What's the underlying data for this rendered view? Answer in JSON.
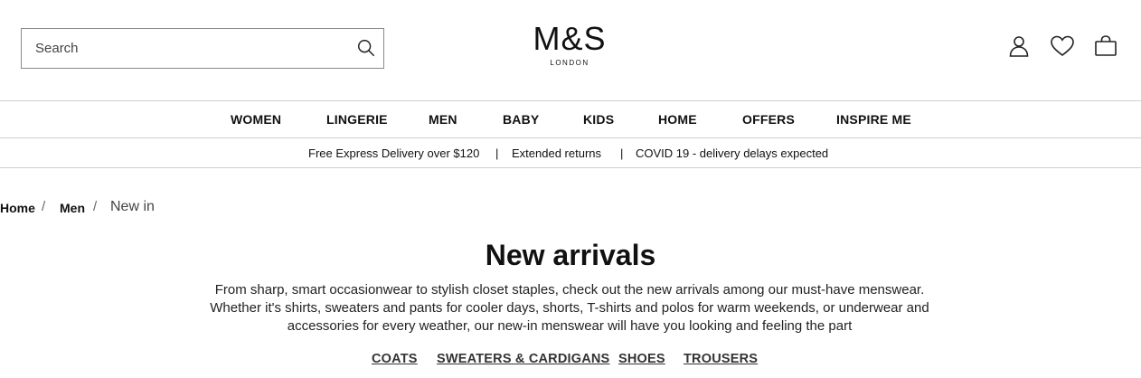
{
  "header": {
    "search": {
      "placeholder": "Search",
      "value": ""
    },
    "logo": {
      "main": "M&S",
      "sub": "LONDON"
    },
    "icons": [
      "account-icon",
      "wishlist-heart-icon",
      "bag-icon"
    ]
  },
  "nav": {
    "items": [
      "WOMEN",
      "LINGERIE",
      "MEN",
      "BABY",
      "KIDS",
      "HOME",
      "OFFERS",
      "INSPIRE ME"
    ]
  },
  "promo": {
    "items": [
      "Free Express Delivery over $120",
      "Extended returns",
      "COVID 19 - delivery delays expected"
    ],
    "separator": "|"
  },
  "breadcrumb": {
    "items": [
      "Home",
      "Men"
    ],
    "current": "New in",
    "separator": "/"
  },
  "main": {
    "title": "New arrivals",
    "description": "From sharp, smart occasionwear to stylish closet staples, check out the new arrivals among our must-have menswear. Whether it's shirts, sweaters and pants for cooler days, shorts, T-shirts and polos for warm weekends, or underwear and accessories for every weather, our new-in menswear will have you looking and feeling the part",
    "categories": [
      "COATS",
      "SWEATERS & CARDIGANS",
      "SHOES",
      "TROUSERS"
    ]
  }
}
